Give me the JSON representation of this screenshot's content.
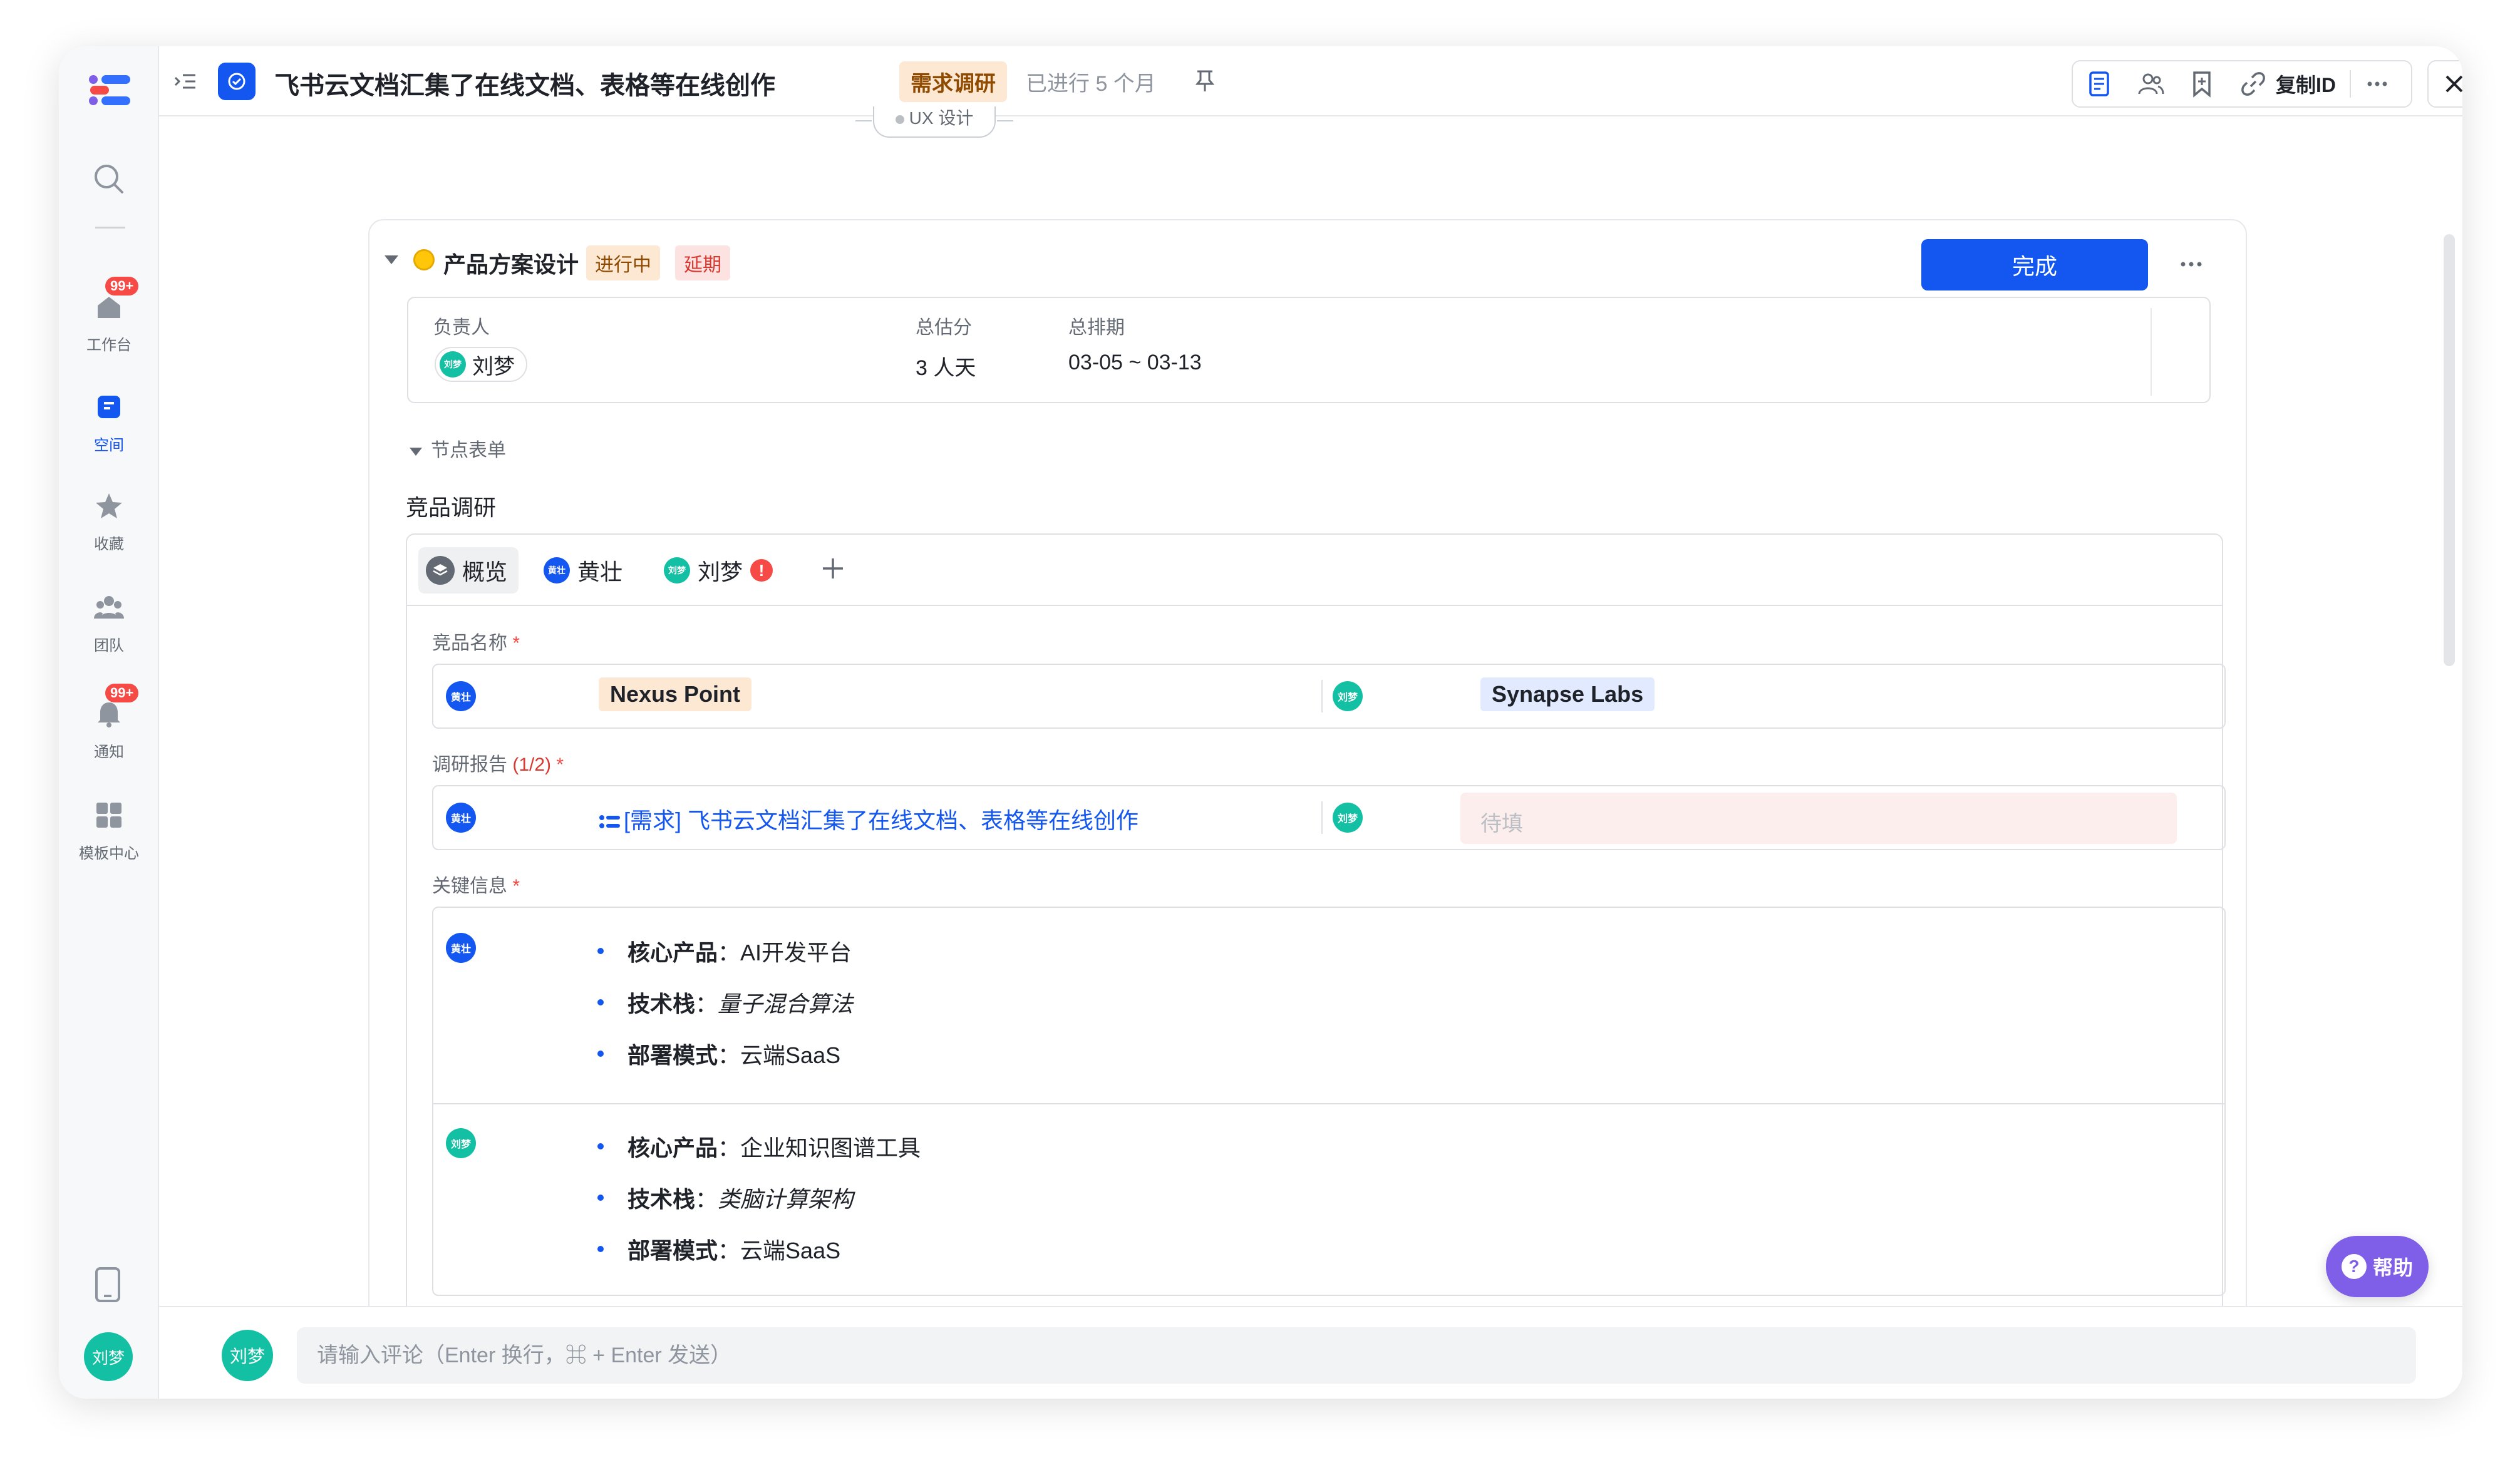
{
  "sidebar": {
    "badge_workbench": "99+",
    "badge_notify": "99+",
    "items": [
      {
        "label": "工作台",
        "icon": "home-icon"
      },
      {
        "label": "空间",
        "icon": "space-icon"
      },
      {
        "label": "收藏",
        "icon": "star-icon"
      },
      {
        "label": "团队",
        "icon": "team-icon"
      },
      {
        "label": "通知",
        "icon": "bell-icon"
      },
      {
        "label": "模板中心",
        "icon": "template-icon"
      }
    ],
    "user_avatar": "刘梦"
  },
  "header": {
    "title": "飞书云文档汇集了在线文档、表格等在线创作",
    "tag": "需求调研",
    "elapsed": "已进行 5 个月",
    "copy_id_label": "复制ID"
  },
  "flow": {
    "prev_node": "UX 设计"
  },
  "stage": {
    "name": "产品方案设计",
    "status_tag": "进行中",
    "delay_tag": "延期",
    "done_label": "完成",
    "owner_label": "负责人",
    "owner_name": "刘梦",
    "estimate_label": "总估分",
    "estimate_value": "3 人天",
    "schedule_label": "总排期",
    "schedule_value": "03-05 ~ 03-13",
    "node_form_label": "节点表单"
  },
  "form": {
    "title": "竞品调研",
    "tabs": [
      {
        "label": "概览"
      },
      {
        "label": "黄壮",
        "avatar": "黄壮"
      },
      {
        "label": "刘梦",
        "avatar": "刘梦"
      }
    ],
    "fields": {
      "competitor_label": "竞品名称",
      "competitor_required": "*",
      "competitor_a": "Nexus Point",
      "competitor_b": "Synapse Labs",
      "report_label": "调研报告",
      "report_count": "(1/2)",
      "report_required": "*",
      "report_link": "[需求] 飞书云文档汇集了在线文档、表格等在线创作",
      "report_pending": "待填",
      "key_label": "关键信息",
      "key_required": "*"
    },
    "key_info": [
      {
        "avatar": "黄壮",
        "items": [
          {
            "key": "核心产品",
            "value": "AI开发平台",
            "italic": false
          },
          {
            "key": "技术栈",
            "value": "量子混合算法",
            "italic": true
          },
          {
            "key": "部署模式",
            "value": "云端SaaS",
            "italic": false
          }
        ]
      },
      {
        "avatar": "刘梦",
        "items": [
          {
            "key": "核心产品",
            "value": "企业知识图谱工具",
            "italic": false
          },
          {
            "key": "技术栈",
            "value": "类脑计算架构",
            "italic": true
          },
          {
            "key": "部署模式",
            "value": "云端SaaS",
            "italic": false
          }
        ]
      }
    ]
  },
  "comment": {
    "avatar": "刘梦",
    "placeholder": "请输入评论（Enter 换行，⌘ + Enter 发送）"
  },
  "help_label": "帮助",
  "colors": {
    "accent": "#1456f0",
    "avatar_green": "#14c0a4",
    "help_purple": "#7f5ee8",
    "stage_yellow": "#ffc60a",
    "danger": "#f54a45"
  }
}
